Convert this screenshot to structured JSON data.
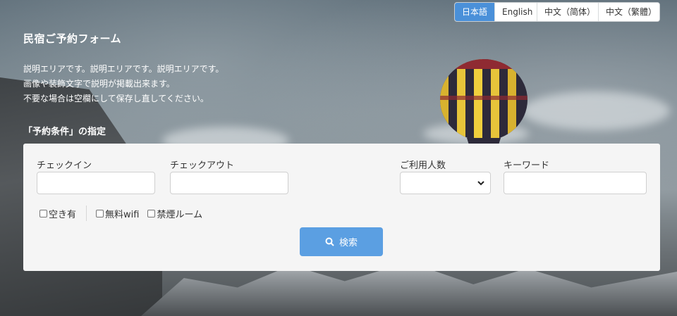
{
  "languages": [
    {
      "label": "日本語",
      "active": true
    },
    {
      "label": "English",
      "active": false
    },
    {
      "label": "中文（简体）",
      "active": false
    },
    {
      "label": "中文（繁體）",
      "active": false
    }
  ],
  "header": {
    "title": "民宿ご予約フォーム",
    "description": [
      "説明エリアです。説明エリアです。説明エリアです。",
      "画像や装飾文字で説明が掲載出来ます。",
      "不要な場合は空欄にして保存し直してください。"
    ],
    "conditions_title": "「予約条件」の指定"
  },
  "form": {
    "checkin_label": "チェックイン",
    "checkin_value": "",
    "checkout_label": "チェックアウト",
    "checkout_value": "",
    "guests_label": "ご利用人数",
    "guests_value": "",
    "keyword_label": "キーワード",
    "keyword_value": "",
    "checkboxes": [
      {
        "label": "空き有",
        "checked": false
      },
      {
        "label": "無料wifi",
        "checked": false
      },
      {
        "label": "禁煙ルーム",
        "checked": false
      }
    ],
    "search_label": "検索"
  },
  "icons": {
    "search": "search-icon",
    "dropdown": "chevron-down-icon"
  },
  "colors": {
    "accent": "#4a90d9",
    "button": "#5b9fe2",
    "panel": "#f5f5f5"
  }
}
